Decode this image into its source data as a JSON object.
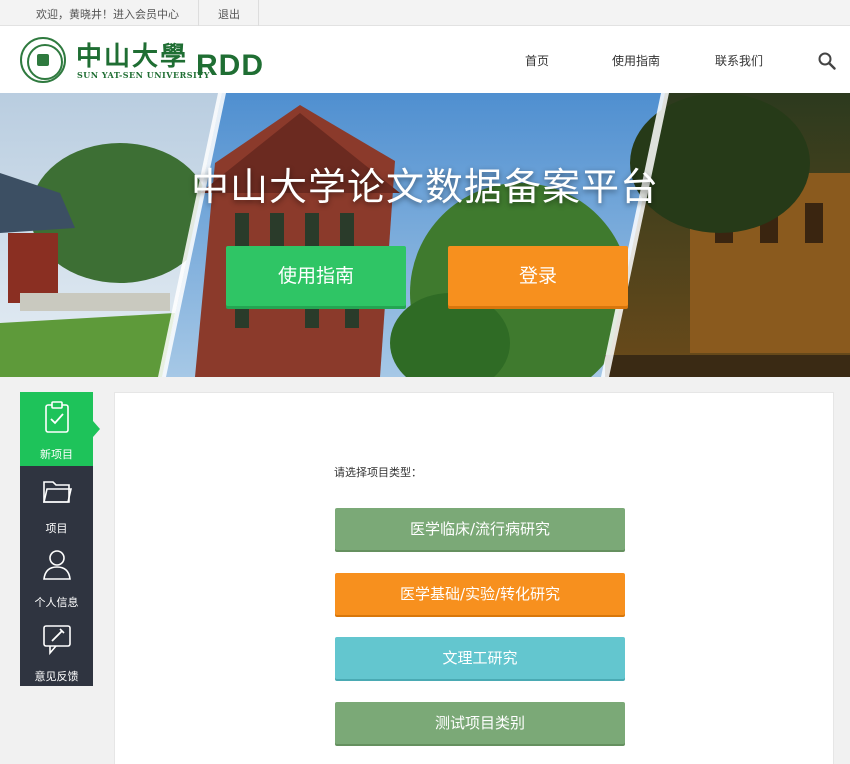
{
  "topbar": {
    "welcome": "欢迎，黄晓井！进入会员中心",
    "logout": "退出"
  },
  "header": {
    "logo_cn": "中山大學",
    "logo_en": "SUN YAT-SEN UNIVERSITY",
    "logo_rdd": "RDD",
    "nav": [
      "首页",
      "使用指南",
      "联系我们"
    ]
  },
  "banner": {
    "title": "中山大学论文数据备案平台",
    "guide_button": "使用指南",
    "login_button": "登录"
  },
  "sidebar": {
    "items": [
      {
        "label": "新项目",
        "icon": "clipboard-check-icon",
        "active": true
      },
      {
        "label": "项目",
        "icon": "folder-icon",
        "active": false
      },
      {
        "label": "个人信息",
        "icon": "user-icon",
        "active": false
      },
      {
        "label": "意见反馈",
        "icon": "feedback-pen-icon",
        "active": false
      }
    ]
  },
  "main": {
    "prompt": "请选择项目类型：",
    "project_types": [
      {
        "label": "医学临床/流行病研究",
        "color": "#7ba977"
      },
      {
        "label": "医学基础/实验/转化研究",
        "color": "#f7901e"
      },
      {
        "label": "文理工研究",
        "color": "#63c6cf"
      },
      {
        "label": "测试项目类别",
        "color": "#7ba977"
      }
    ]
  },
  "colors": {
    "brand_green": "#1f6e33",
    "accent_green": "#1ec35a",
    "orange": "#f7901e",
    "sidebar_bg": "#2f3440"
  }
}
